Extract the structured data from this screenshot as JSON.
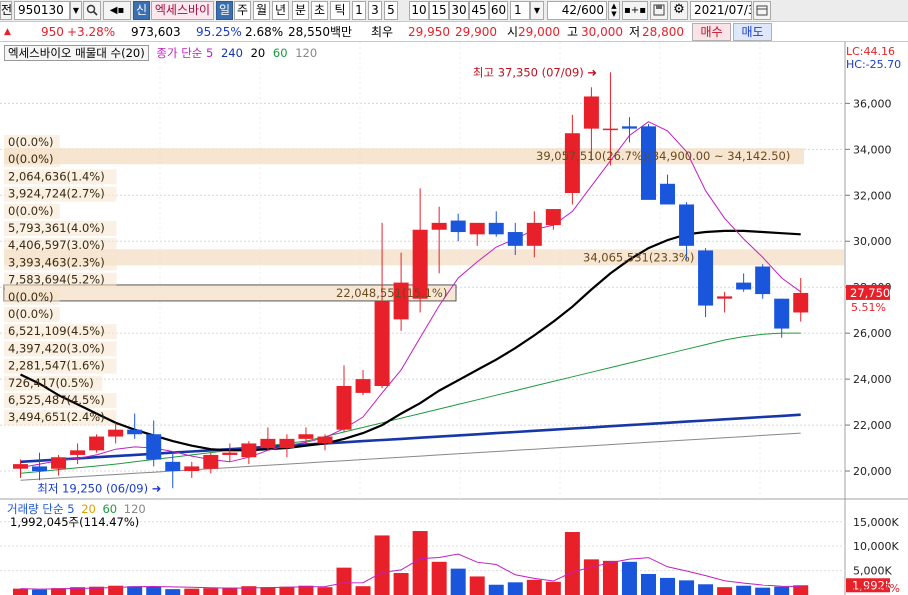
{
  "toolbar": {
    "left_edge": "전",
    "code": "950130",
    "tabs": [
      {
        "label": "신",
        "selected": true
      },
      {
        "label": "엑세스바이",
        "selected": false
      },
      {
        "label": "일",
        "selected": true
      },
      {
        "label": "주",
        "selected": false
      },
      {
        "label": "월",
        "selected": false
      },
      {
        "label": "년",
        "selected": false
      },
      {
        "label": "분",
        "selected": false
      },
      {
        "label": "초",
        "selected": false
      },
      {
        "label": "틱",
        "selected": false
      }
    ],
    "periods": [
      "1",
      "3",
      "5",
      "10",
      "15",
      "30",
      "45",
      "60"
    ],
    "period_value": "1",
    "count": "42",
    "count_total": "/600",
    "date": "2021/07/3"
  },
  "status": {
    "arrow": "▲",
    "change": "950",
    "change_pct": "+3.28%",
    "volume": "973,603",
    "ratio": "95.25%",
    "turnover": "2.68%",
    "amount": "28,550백만",
    "top_label": "최우",
    "best_ask": "29,950",
    "best_bid": "29,900",
    "open_label": "시",
    "open": "29,000",
    "high_label": "고",
    "high": "30,000",
    "low_label": "저",
    "low": "28,800",
    "buy_label": "매수",
    "sell_label": "매도"
  },
  "legend": {
    "name": "엑세스바이오 매물대 수(20)",
    "ma_label": "종가 단순 5",
    "ma_periods": [
      "240",
      "20",
      "60",
      "120"
    ]
  },
  "price_axis": {
    "lc": "LC:44.16",
    "hc": "HC:-25.70",
    "ticks": [
      "36,000",
      "34,000",
      "32,000",
      "30,000",
      "28,000",
      "26,000",
      "24,000",
      "22,000",
      "20,000"
    ],
    "current": "27,750",
    "current_pct": "5.51%"
  },
  "annotations": {
    "high": "최고 37,350 (07/09)",
    "low": "최저 19,250 (06/09)",
    "box_top": "39,057,510(26.7%)(34,900.00 ~ 34,142.50)",
    "box_mid": "34,065,531(23.3%)",
    "box_cur": "22,048,551(15.1%)"
  },
  "volume_profile": [
    {
      "label": "0(0.0%)",
      "price": 34950
    },
    {
      "label": "0(0.0%)",
      "price": 34500
    },
    {
      "label": "2,064,636(1.4%)",
      "price": 33950
    },
    {
      "label": "3,924,724(2.7%)",
      "price": 33550
    },
    {
      "label": "0(0.0%)",
      "price": 33150
    },
    {
      "label": "5,793,361(4.0%)",
      "price": 32500
    },
    {
      "label": "4,406,597(3.0%)",
      "price": 31750
    },
    {
      "label": "3,393,463(2.3%)",
      "price": 30550
    },
    {
      "label": "7,583,694(5.2%)",
      "price": 30150
    },
    {
      "label": "0(0.0%)",
      "price": 29750
    },
    {
      "label": "0(0.0%)",
      "price": 29350
    },
    {
      "label": "6,521,109(4.5%)",
      "price": 28850
    },
    {
      "label": "4,397,420(3.0%)",
      "price": 28500
    },
    {
      "label": "2,281,547(1.6%)",
      "price": 28100
    },
    {
      "label": "726,417(0.5%)",
      "price": 27700
    },
    {
      "label": "6,525,487(4.5%)",
      "price": 27300
    },
    {
      "label": "3,494,651(2.4%)",
      "price": 26900
    }
  ],
  "volume_panel": {
    "label": "거래량 단순 5",
    "ma_periods": [
      "20",
      "60",
      "120"
    ],
    "value": "1,992,045주(114.47%)",
    "ticks": [
      "15,000K",
      "10,000K",
      "5,000K"
    ],
    "current": "1,992K",
    "current_pct": "114.47%"
  },
  "chart_data": {
    "type": "candlestick",
    "candles": [
      {
        "o": 20100,
        "h": 20500,
        "l": 19700,
        "c": 20300,
        "v": 1300
      },
      {
        "o": 20200,
        "h": 20800,
        "l": 19600,
        "c": 20000,
        "v": 1100
      },
      {
        "o": 20100,
        "h": 20700,
        "l": 19800,
        "c": 20600,
        "v": 1400
      },
      {
        "o": 20700,
        "h": 21200,
        "l": 20300,
        "c": 20900,
        "v": 1600
      },
      {
        "o": 20900,
        "h": 21600,
        "l": 20800,
        "c": 21500,
        "v": 1700
      },
      {
        "o": 21500,
        "h": 22100,
        "l": 21200,
        "c": 21800,
        "v": 1900
      },
      {
        "o": 21800,
        "h": 22500,
        "l": 21400,
        "c": 21600,
        "v": 1800
      },
      {
        "o": 21600,
        "h": 22200,
        "l": 20200,
        "c": 20500,
        "v": 1700
      },
      {
        "o": 20400,
        "h": 20800,
        "l": 19250,
        "c": 20000,
        "v": 1200
      },
      {
        "o": 20000,
        "h": 20400,
        "l": 19700,
        "c": 20200,
        "v": 1300
      },
      {
        "o": 20100,
        "h": 20800,
        "l": 19900,
        "c": 20700,
        "v": 1400
      },
      {
        "o": 20700,
        "h": 21200,
        "l": 20400,
        "c": 20800,
        "v": 1500
      },
      {
        "o": 20600,
        "h": 21300,
        "l": 20300,
        "c": 21200,
        "v": 1800
      },
      {
        "o": 21000,
        "h": 21900,
        "l": 20900,
        "c": 21400,
        "v": 1600
      },
      {
        "o": 21000,
        "h": 21600,
        "l": 20600,
        "c": 21400,
        "v": 1700
      },
      {
        "o": 21400,
        "h": 21900,
        "l": 21200,
        "c": 21600,
        "v": 1900
      },
      {
        "o": 21200,
        "h": 21600,
        "l": 20900,
        "c": 21500,
        "v": 1600
      },
      {
        "o": 21800,
        "h": 24600,
        "l": 21700,
        "c": 23700,
        "v": 5600
      },
      {
        "o": 23400,
        "h": 24400,
        "l": 23300,
        "c": 24000,
        "v": 1800
      },
      {
        "o": 23700,
        "h": 30800,
        "l": 23600,
        "c": 27400,
        "v": 12200
      },
      {
        "o": 26600,
        "h": 29500,
        "l": 26100,
        "c": 28200,
        "v": 4500
      },
      {
        "o": 27500,
        "h": 32300,
        "l": 26900,
        "c": 30500,
        "v": 13100
      },
      {
        "o": 30500,
        "h": 31500,
        "l": 28600,
        "c": 30800,
        "v": 6800
      },
      {
        "o": 30900,
        "h": 31200,
        "l": 30000,
        "c": 30400,
        "v": 5400
      },
      {
        "o": 30300,
        "h": 30800,
        "l": 29800,
        "c": 30800,
        "v": 3800
      },
      {
        "o": 30800,
        "h": 31300,
        "l": 30200,
        "c": 30300,
        "v": 2100
      },
      {
        "o": 30400,
        "h": 30800,
        "l": 29400,
        "c": 29800,
        "v": 2600
      },
      {
        "o": 29800,
        "h": 31300,
        "l": 29300,
        "c": 30800,
        "v": 3100
      },
      {
        "o": 30700,
        "h": 31400,
        "l": 30500,
        "c": 31400,
        "v": 2700
      },
      {
        "o": 32100,
        "h": 35500,
        "l": 31600,
        "c": 34700,
        "v": 12900
      },
      {
        "o": 34900,
        "h": 36700,
        "l": 33500,
        "c": 36300,
        "v": 7300
      },
      {
        "o": 34900,
        "h": 37350,
        "l": 33300,
        "c": 34900,
        "v": 7000
      },
      {
        "o": 35000,
        "h": 35400,
        "l": 34300,
        "c": 34900,
        "v": 6800
      },
      {
        "o": 35000,
        "h": 35100,
        "l": 32700,
        "c": 31800,
        "v": 4300
      },
      {
        "o": 32500,
        "h": 32900,
        "l": 31700,
        "c": 31600,
        "v": 3500
      },
      {
        "o": 31600,
        "h": 31700,
        "l": 29200,
        "c": 29800,
        "v": 3000
      },
      {
        "o": 29600,
        "h": 29700,
        "l": 26700,
        "c": 27200,
        "v": 2200
      },
      {
        "o": 27500,
        "h": 27800,
        "l": 26900,
        "c": 27600,
        "v": 1600
      },
      {
        "o": 28200,
        "h": 28600,
        "l": 27800,
        "c": 27900,
        "v": 1900
      },
      {
        "o": 28900,
        "h": 29000,
        "l": 27500,
        "c": 27700,
        "v": 1500
      },
      {
        "o": 27500,
        "h": 27500,
        "l": 25800,
        "c": 26200,
        "v": 1700
      },
      {
        "o": 26900,
        "h": 28400,
        "l": 26500,
        "c": 27750,
        "v": 1992
      }
    ],
    "ma5": [
      20150,
      20300,
      20450,
      20550,
      20700,
      20950,
      21050,
      21000,
      20850,
      20650,
      20500,
      20400,
      20600,
      20900,
      21100,
      21250,
      21450,
      21850,
      22350,
      23400,
      24400,
      25800,
      27200,
      28400,
      29100,
      29750,
      30100,
      30500,
      30700,
      31300,
      32400,
      33500,
      34600,
      35200,
      34800,
      33900,
      32200,
      31000,
      30100,
      29300,
      28400,
      27800
    ],
    "ma20": [
      24200,
      23800,
      23300,
      22900,
      22500,
      22100,
      21800,
      21550,
      21300,
      21100,
      20950,
      20900,
      20900,
      20950,
      21000,
      21100,
      21200,
      21400,
      21650,
      22000,
      22500,
      22950,
      23500,
      23950,
      24400,
      24850,
      25350,
      25900,
      26500,
      27150,
      27900,
      28600,
      29200,
      29700,
      30050,
      30300,
      30400,
      30450,
      30450,
      30400,
      30350,
      30300
    ],
    "ma60": [
      19900,
      19980,
      20060,
      20140,
      20220,
      20300,
      20400,
      20500,
      20600,
      20700,
      20800,
      20900,
      21000,
      21100,
      21200,
      21300,
      21500,
      21700,
      21900,
      22100,
      22300,
      22500,
      22700,
      22900,
      23100,
      23300,
      23500,
      23700,
      23900,
      24100,
      24300,
      24500,
      24700,
      24900,
      25100,
      25300,
      25500,
      25700,
      25850,
      25950,
      26000,
      26000
    ],
    "ma120": [
      19600,
      19650,
      19700,
      19750,
      19800,
      19850,
      19900,
      19950,
      20000,
      20050,
      20100,
      20150,
      20200,
      20250,
      20300,
      20350,
      20400,
      20450,
      20500,
      20550,
      20600,
      20650,
      20700,
      20750,
      20800,
      20850,
      20900,
      20950,
      21000,
      21050,
      21100,
      21150,
      21200,
      21250,
      21300,
      21350,
      21400,
      21450,
      21500,
      21550,
      21600,
      21650
    ],
    "ma240": [
      20400,
      20450,
      20500,
      20550,
      20600,
      20650,
      20700,
      20750,
      20800,
      20850,
      20900,
      20950,
      21000,
      21050,
      21100,
      21150,
      21200,
      21250,
      21300,
      21350,
      21400,
      21450,
      21500,
      21550,
      21600,
      21650,
      21700,
      21750,
      21800,
      21850,
      21900,
      21950,
      22000,
      22050,
      22100,
      22150,
      22200,
      22250,
      22300,
      22350,
      22400,
      22450
    ],
    "ylim": [
      19000,
      37800
    ],
    "vol_ylim": [
      0,
      17000
    ]
  },
  "colors": {
    "up": "#e8202a",
    "down": "#1a56db",
    "ma5": "#c020c0",
    "ma20": "#000000",
    "ma60": "#1e9a3c",
    "ma120": "#888888",
    "ma240": "#1736a8"
  }
}
